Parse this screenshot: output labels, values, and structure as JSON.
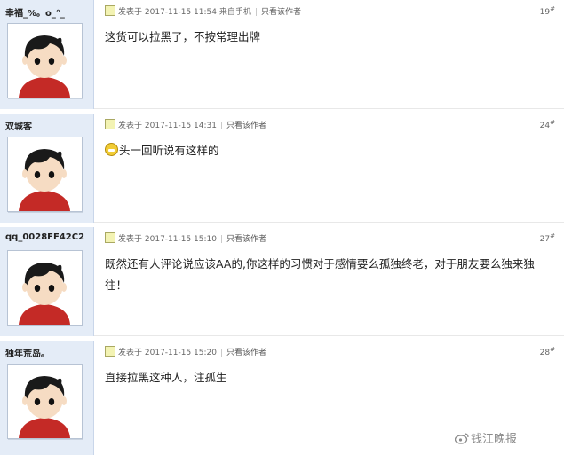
{
  "posts": [
    {
      "username": "幸福_%。o_°_",
      "posted_label": "发表于",
      "datetime": "2017-11-15 11:54",
      "source": "来自手机",
      "only_author": "只看该作者",
      "floor": "19",
      "floor_mark": "#",
      "content": "这货可以拉黑了，不按常理出牌",
      "has_emoji": false
    },
    {
      "username": "双城客",
      "posted_label": "发表于",
      "datetime": "2017-11-15 14:31",
      "source": "",
      "only_author": "只看该作者",
      "floor": "24",
      "floor_mark": "#",
      "content": "头一回听说有这样的",
      "has_emoji": true,
      "emoji_icon": "grin-emoji-icon"
    },
    {
      "username": "qq_0028FF42C2",
      "posted_label": "发表于",
      "datetime": "2017-11-15 15:10",
      "source": "",
      "only_author": "只看该作者",
      "floor": "27",
      "floor_mark": "#",
      "content": "既然还有人评论说应该AA的,你这样的习惯对于感情要么孤独终老，对于朋友要么独来独往！",
      "has_emoji": false
    },
    {
      "username": "独年荒岛。",
      "posted_label": "发表于",
      "datetime": "2017-11-15 15:20",
      "source": "",
      "only_author": "只看该作者",
      "floor": "28",
      "floor_mark": "#",
      "content": "直接拉黑这种人，注孤生",
      "has_emoji": false
    }
  ],
  "watermark": {
    "text": "钱江晚报",
    "icon": "weibo-icon"
  },
  "colors": {
    "sidebar": "#e4ecf7",
    "text": "#222222",
    "meta": "#666666"
  }
}
